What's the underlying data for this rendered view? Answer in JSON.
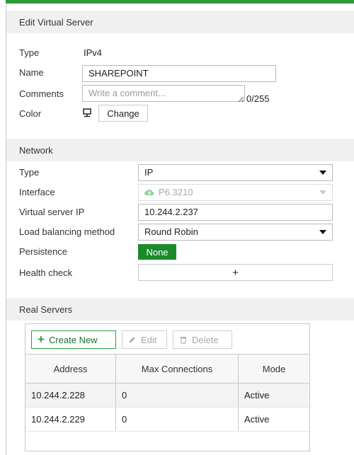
{
  "header": {
    "title": "Edit Virtual Server"
  },
  "general": {
    "type_label": "Type",
    "type_value": "IPv4",
    "name_label": "Name",
    "name_value": "SHAREPOINT",
    "comments_label": "Comments",
    "comments_placeholder": "Write a comment...",
    "comments_counter": "0/255",
    "color_label": "Color",
    "change_button": "Change"
  },
  "network": {
    "section_title": "Network",
    "type_label": "Type",
    "type_value": "IP",
    "interface_label": "Interface",
    "interface_value": "P6.3210",
    "vip_label": "Virtual server IP",
    "vip_value": "10.244.2.237",
    "lb_label": "Load balancing method",
    "lb_value": "Round Robin",
    "persistence_label": "Persistence",
    "persistence_value": "None",
    "health_label": "Health check",
    "health_add": "+"
  },
  "real_servers": {
    "section_title": "Real Servers",
    "toolbar": {
      "create": "Create New",
      "edit": "Edit",
      "delete": "Delete"
    },
    "columns": [
      "Address",
      "Max Connections",
      "Mode"
    ],
    "rows": [
      {
        "address": "10.244.2.228",
        "max": "0",
        "mode": "Active"
      },
      {
        "address": "10.244.2.229",
        "max": "0",
        "mode": "Active"
      }
    ]
  },
  "colors": {
    "accent": "#2e9c3c",
    "badge": "#1a8a2a"
  }
}
